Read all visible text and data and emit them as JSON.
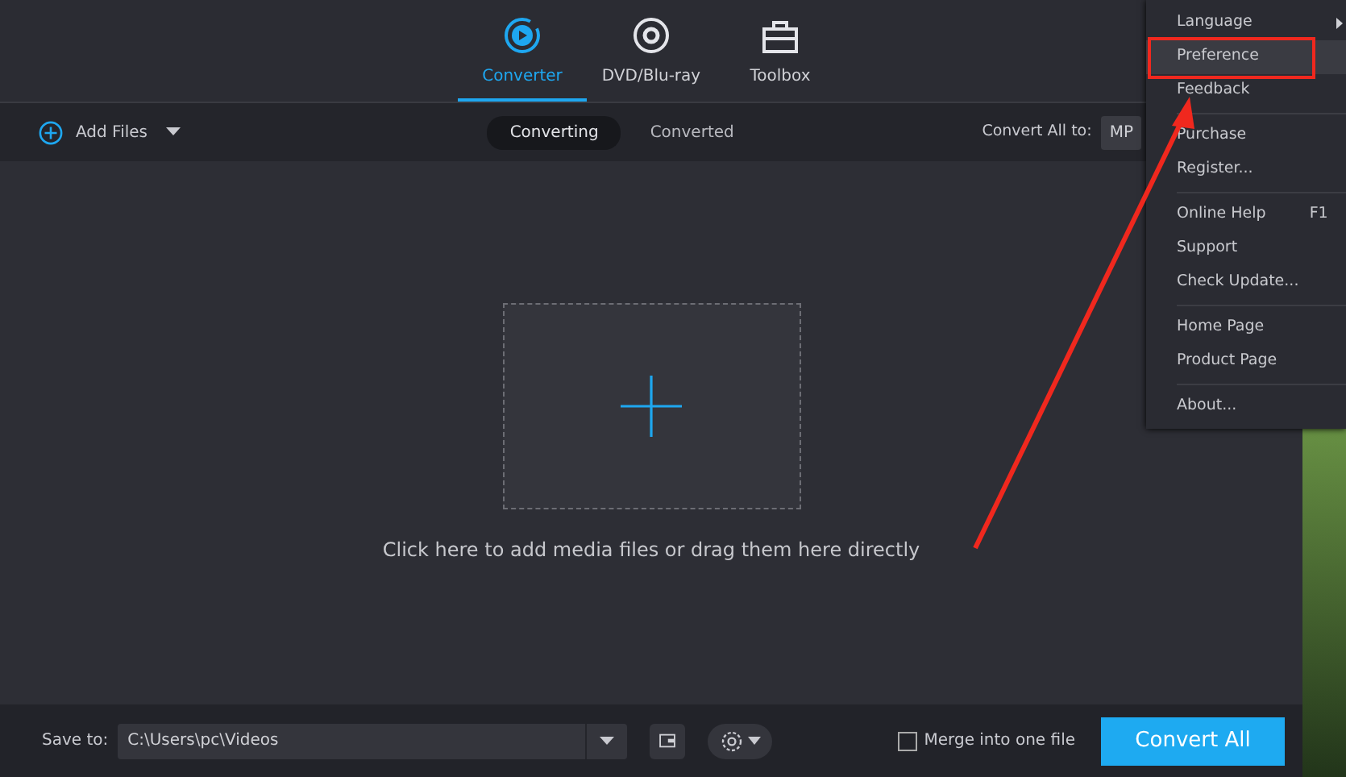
{
  "nav_tabs": [
    {
      "label": "Converter",
      "selected": true
    },
    {
      "label": "DVD/Blu-ray",
      "selected": false
    },
    {
      "label": "Toolbox",
      "selected": false
    }
  ],
  "toolbar": {
    "add_files": "Add Files",
    "segments": [
      {
        "label": "Converting",
        "selected": true
      },
      {
        "label": "Converted",
        "selected": false
      }
    ],
    "convert_all_to": "Convert All to:",
    "format": "MP"
  },
  "drop_zone": {
    "hint": "Click here to add media files or drag them here directly"
  },
  "bottom_bar": {
    "save_to": "Save to:",
    "path": "C:\\Users\\pc\\Videos",
    "merge": {
      "label": "Merge into one file",
      "checked": false
    },
    "convert_button": "Convert All"
  },
  "menu": [
    [
      {
        "label": "Language",
        "submenu": true,
        "selected": false
      },
      {
        "label": "Preference",
        "selected": true
      },
      {
        "label": "Feedback",
        "selected": false
      }
    ],
    [
      {
        "label": "Purchase",
        "selected": false
      },
      {
        "label": "Register...",
        "selected": false
      }
    ],
    [
      {
        "label": "Online Help",
        "shortcut": "F1",
        "selected": false
      },
      {
        "label": "Support",
        "selected": false
      },
      {
        "label": "Check Update...",
        "selected": false
      }
    ],
    [
      {
        "label": "Home Page",
        "selected": false
      },
      {
        "label": "Product Page",
        "selected": false
      }
    ],
    [
      {
        "label": "About...",
        "selected": false
      }
    ]
  ]
}
